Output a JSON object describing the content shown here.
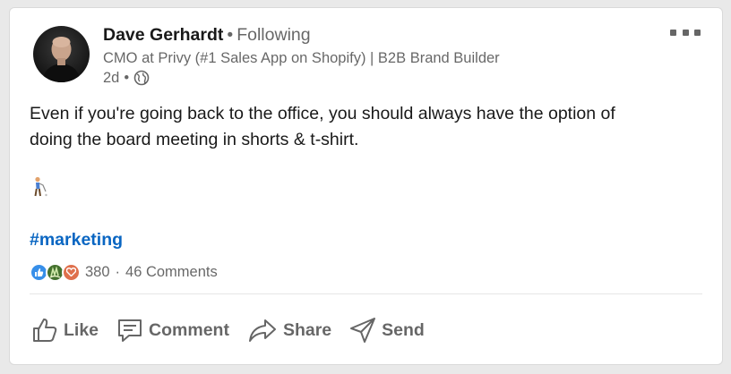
{
  "post": {
    "author": {
      "name": "Dave Gerhardt",
      "follow_status": "Following",
      "headline": "CMO at Privy (#1 Sales App on Shopify) | B2B Brand Builder",
      "time_ago": "2d",
      "visibility_icon": "globe-icon"
    },
    "separator": "•",
    "text_lines": [
      "Even if you're going back to the office, you should always have the option of",
      "doing the board meeting in shorts & t-shirt."
    ],
    "emoji": "golfer-icon",
    "hashtag": "#marketing",
    "reactions": {
      "types": [
        "like-icon",
        "celebrate-icon",
        "love-icon"
      ],
      "count": "380",
      "separator": "·",
      "comments": "46 Comments"
    },
    "actions": [
      {
        "label": "Like",
        "icon": "thumbs-up-icon"
      },
      {
        "label": "Comment",
        "icon": "comment-icon"
      },
      {
        "label": "Share",
        "icon": "share-arrow-icon"
      },
      {
        "label": "Send",
        "icon": "paper-plane-icon"
      }
    ]
  },
  "colors": {
    "link": "#0a66c2",
    "like": "#378fe9",
    "celebrate": "#44712e",
    "love": "#df704d"
  }
}
